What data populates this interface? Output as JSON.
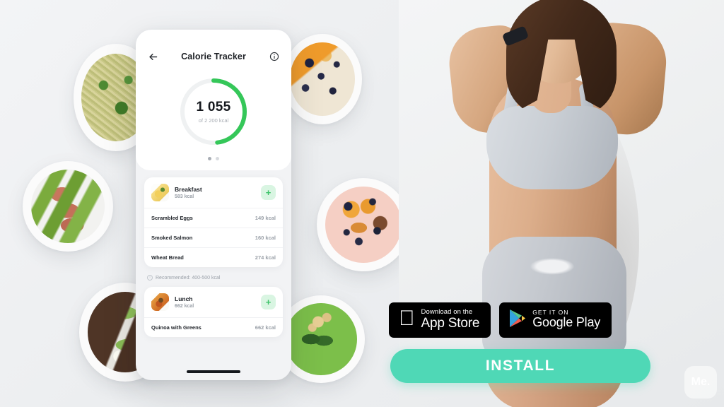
{
  "app": {
    "screen_title": "Calorie Tracker",
    "back_icon": "back-arrow-icon",
    "info_icon": "info-icon"
  },
  "calorie_ring": {
    "value": "1 055",
    "goal_text": "of 2 200 kcal",
    "consumed": 1055,
    "goal": 2200,
    "percent": 48,
    "track_color": "#eef0f1",
    "progress_color": "#35c759"
  },
  "pager": {
    "count": 2,
    "active_index": 0
  },
  "meals": [
    {
      "name": "Breakfast",
      "kcal": "583 kcal",
      "thumb": "scrambled-eggs-thumb",
      "add_label": "+",
      "items": [
        {
          "name": "Scrambled Eggs",
          "kcal": "149 kcal"
        },
        {
          "name": "Smoked Salmon",
          "kcal": "160 kcal"
        },
        {
          "name": "Wheat Bread",
          "kcal": "274 kcal"
        }
      ]
    },
    {
      "name": "Lunch",
      "kcal": "662 kcal",
      "thumb": "pasta-bolognese-thumb",
      "add_label": "+",
      "items": [
        {
          "name": "Quinoa with Greens",
          "kcal": "662 kcal"
        }
      ]
    }
  ],
  "recommendation": {
    "icon": "info-circle-icon",
    "text": "Recommended: 400-500 kcal"
  },
  "store_badges": [
    {
      "icon": "apple-logo-icon",
      "line1": "Download on the",
      "line2": "App Store"
    },
    {
      "icon": "google-play-icon",
      "line1": "GET IT ON",
      "line2": "Google Play"
    }
  ],
  "cta": {
    "label": "INSTALL",
    "color": "#4fd8b6"
  },
  "brand": {
    "logo_text": "Me."
  },
  "food_photos": [
    {
      "name": "pesto-pasta-plate"
    },
    {
      "name": "bacon-wrapped-asparagus-plate"
    },
    {
      "name": "avocado-toast-plate"
    },
    {
      "name": "oatmeal-berries-bowl"
    },
    {
      "name": "smoothie-bowl"
    },
    {
      "name": "green-soup-bowl"
    }
  ],
  "model_photo": {
    "name": "fitness-model-photo"
  }
}
